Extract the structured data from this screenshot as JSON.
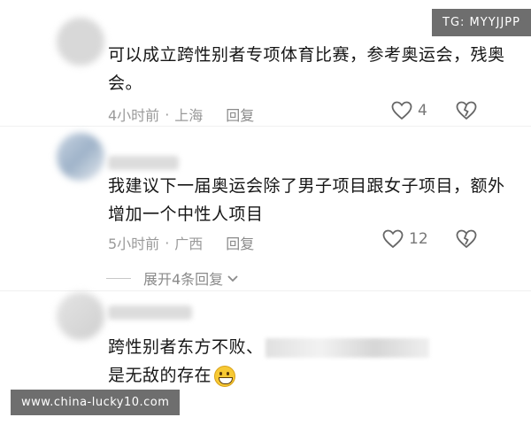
{
  "badges": {
    "telegram": "TG: MYYJJPP",
    "watermark": "www.china-lucky10.com"
  },
  "comments": [
    {
      "text": "可以成立跨性别者专项体育比赛，参考奥运会，残奥会。",
      "time": "4小时前",
      "location": "上海",
      "reply_label": "回复",
      "likes": "4"
    },
    {
      "text": "我建议下一届奥运会除了男子项目跟女子项目，额外增加一个中性人项目",
      "time": "5小时前",
      "location": "广西",
      "reply_label": "回复",
      "likes": "12",
      "expand_label": "展开4条回复"
    },
    {
      "text_before": "跨性别者东方不败、",
      "text_after": "是无敌的存在",
      "emoji": "grinning-face"
    }
  ],
  "icons": {
    "like": "heart-outline-icon",
    "dislike": "broken-heart-icon",
    "expand": "chevron-down-icon"
  }
}
